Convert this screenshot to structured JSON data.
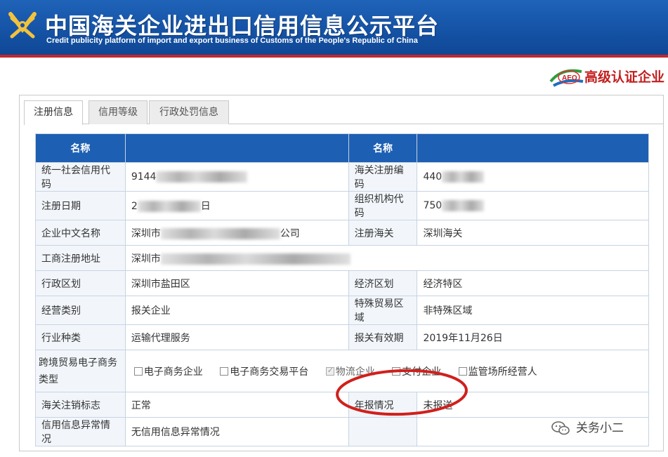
{
  "header": {
    "title_cn": "中国海关企业进出口信用信息公示平台",
    "title_en": "Credit publicity platform of import and export business of Customs of the People's Republic of China",
    "logo_icon": "customs-emblem-icon",
    "bg_color": "#1553a6",
    "accent_color": "#c4272d"
  },
  "badge": {
    "aeo_label": "AEO",
    "text": "高级认证企业"
  },
  "tabs": [
    {
      "label": "注册信息",
      "active": true
    },
    {
      "label": "信用等级",
      "active": false
    },
    {
      "label": "行政处罚信息",
      "active": false
    }
  ],
  "table": {
    "headers": [
      "名称",
      "",
      "名称",
      ""
    ],
    "rows": [
      {
        "l1": "统一社会信用代码",
        "v1": "9144",
        "l2": "海关注册编码",
        "v2": "440"
      },
      {
        "l1": "注册日期",
        "v1": "2",
        "v1_suffix": "日",
        "l2": "组织机构代码",
        "v2": "750"
      },
      {
        "l1": "企业中文名称",
        "v1": "深圳市",
        "v1_suffix": "公司",
        "l2": "注册海关",
        "v2": "深圳海关"
      },
      {
        "l1": "工商注册地址",
        "v1": "深圳市"
      },
      {
        "l1": "行政区划",
        "v1": "深圳市盐田区",
        "l2": "经济区划",
        "v2": "经济特区"
      },
      {
        "l1": "经营类别",
        "v1": "报关企业",
        "l2": "特殊贸易区域",
        "v2": "非特殊区域"
      },
      {
        "l1": "行业种类",
        "v1": "运输代理服务",
        "l2": "报关有效期",
        "v2": "2019年11月26日"
      },
      {
        "l1": "跨境贸易电子商务类型",
        "options": [
          {
            "label": "电子商务企业",
            "checked": false
          },
          {
            "label": "电子商务交易平台",
            "checked": false
          },
          {
            "label": "物流企业",
            "checked": true
          },
          {
            "label": "支付企业",
            "checked": false
          },
          {
            "label": "监管场所经营人",
            "checked": false
          }
        ]
      },
      {
        "l1": "海关注销标志",
        "v1": "正常",
        "l2": "年报情况",
        "v2": "未报送"
      },
      {
        "l1": "信用信息异常情况",
        "v1": "无信用信息异常情况"
      }
    ],
    "header_color": "#1d5fb3"
  },
  "watermark": {
    "icon": "wechat-icon",
    "text": "关务小二"
  },
  "highlight_color": "#d0201c"
}
